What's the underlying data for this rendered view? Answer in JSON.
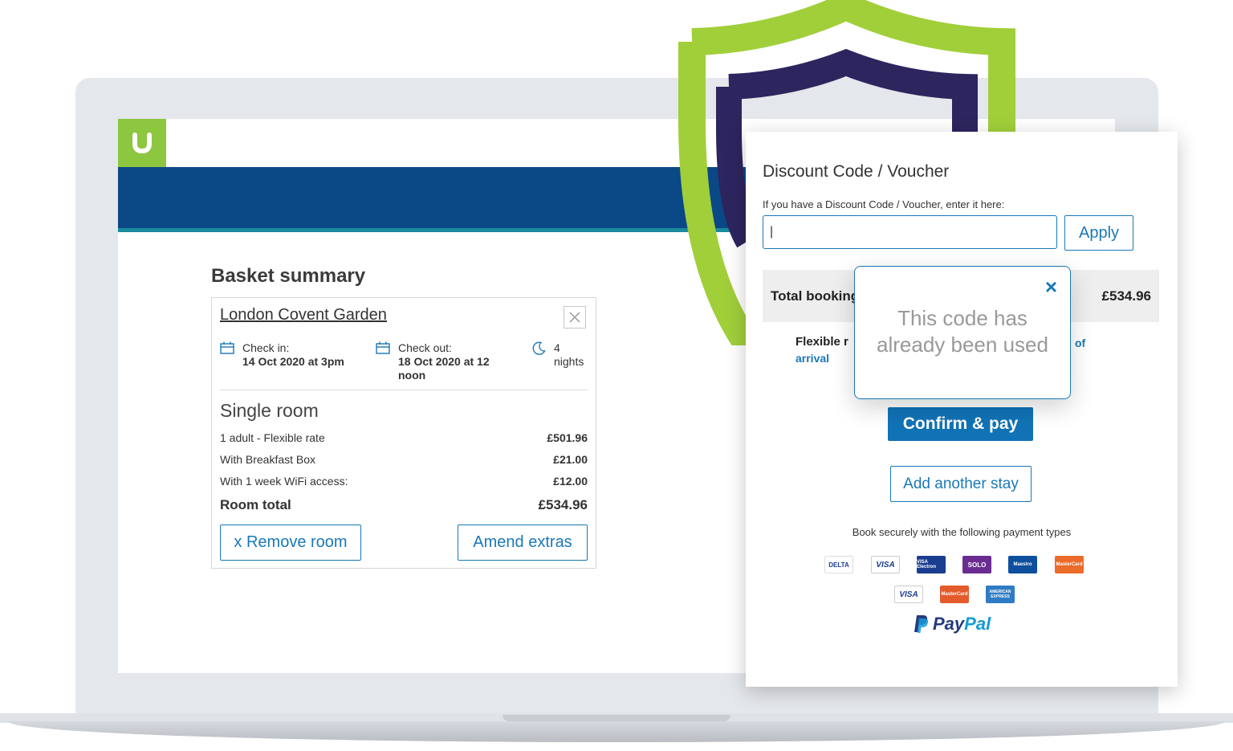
{
  "brand": {
    "logo_letter": "u",
    "logo_color": "#8dc63f",
    "band_color": "#0b4886",
    "accent": "#1a78b8",
    "shield_outer": "#a1cf3a",
    "shield_inner": "#2d255e"
  },
  "basket": {
    "title": "Basket summary",
    "hotel": "London Covent Garden",
    "check_in_label": "Check in:",
    "check_in_value": "14 Oct 2020 at 3pm",
    "check_out_label": "Check out:",
    "check_out_value": "18 Oct 2020 at 12 noon",
    "nights_count": "4",
    "nights_label": "nights",
    "room_title": "Single room",
    "lines": [
      {
        "label": "1 adult - Flexible rate",
        "amount": "£501.96"
      },
      {
        "label": "With Breakfast Box",
        "amount": "£21.00"
      },
      {
        "label": "With 1 week WiFi access:",
        "amount": "£12.00"
      }
    ],
    "room_total_label": "Room total",
    "room_total_value": "£534.96",
    "remove_button": "x Remove room",
    "amend_button": "Amend extras"
  },
  "panel": {
    "title": "Discount Code / Voucher",
    "subtitle": "If you have a Discount Code / Voucher, enter it here:",
    "input_value": "|",
    "apply_button": "Apply",
    "total_label": "Total booking",
    "total_value": "£534.96",
    "flex_text": "Flexible r",
    "of_text": "of",
    "arrival_text": "arrival",
    "confirm_button": "Confirm & pay",
    "add_stay_button": "Add another stay",
    "secure_text": "Book securely with the following payment types",
    "payment_cards": [
      "DELTA",
      "VISA",
      "VISA Electron",
      "SOLO",
      "Maestro",
      "MasterCard",
      "VISA",
      "MasterCard",
      "AMERICAN EXPRESS"
    ],
    "paypal_1": "Pay",
    "paypal_2": "Pal"
  },
  "popup": {
    "close_icon": "×",
    "message_line1": "This code has",
    "message_line2": "already been used"
  }
}
